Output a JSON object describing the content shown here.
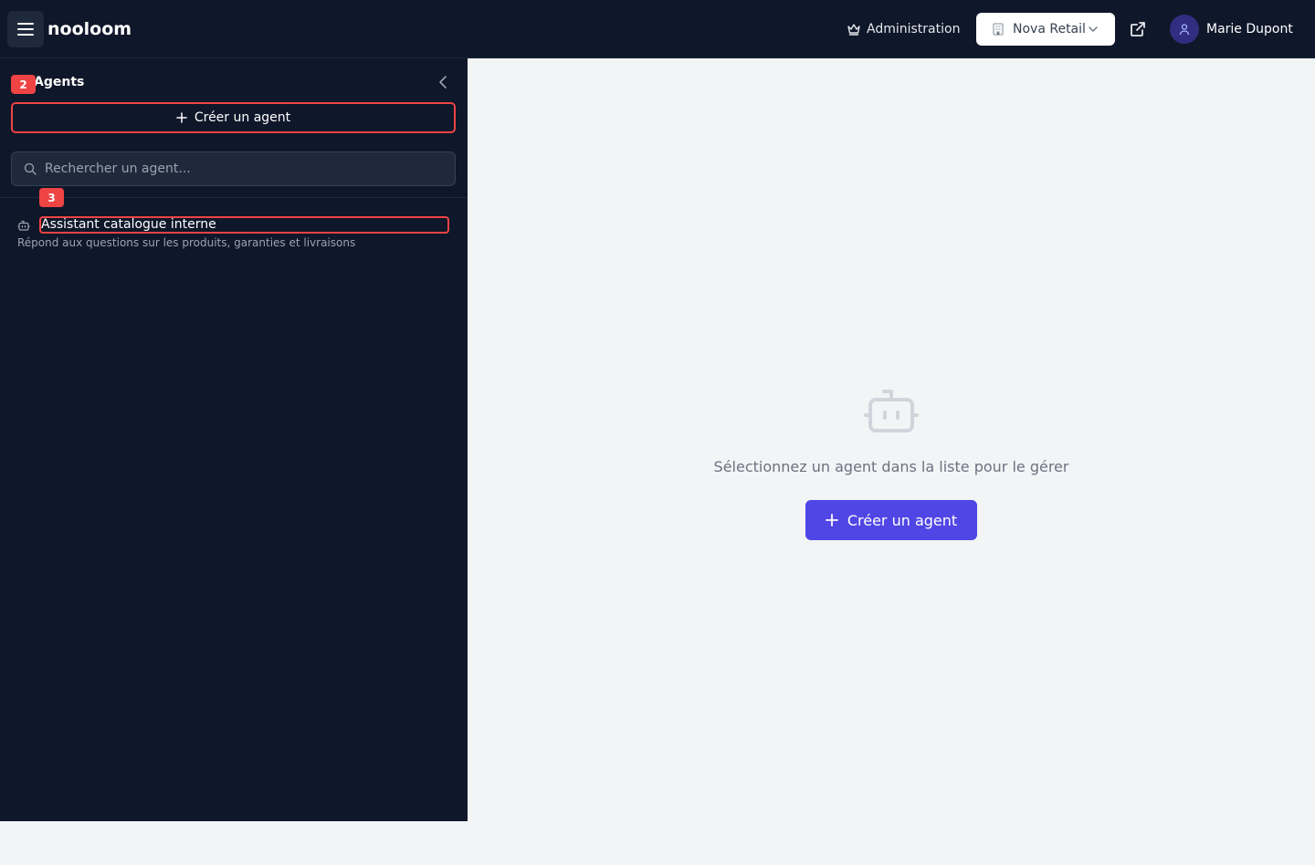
{
  "app": {
    "brand": "nooloom"
  },
  "header": {
    "admin_label": "Administration",
    "org_label": "Nova Retail",
    "user_name": "Marie Dupont"
  },
  "sidebar": {
    "title": "Agents",
    "create_label": "Créer un agent",
    "search": {
      "placeholder": "Rechercher un agent...",
      "value": ""
    },
    "items": [
      {
        "name": "Assistant catalogue interne",
        "description": "Répond aux questions sur les produits, garanties et livraisons"
      }
    ]
  },
  "annotations": {
    "badge_a": "2",
    "badge_b": "3"
  },
  "main": {
    "empty_message": "Sélectionnez un agent dans la liste pour le gérer",
    "create_label": "Créer un agent"
  },
  "colors": {
    "nav_bg": "#0f172a",
    "accent": "#4f46e5",
    "highlight": "#ef4444",
    "main_bg": "#f3f4f6"
  },
  "icons": [
    "menu-icon",
    "crown-icon",
    "building-icon",
    "chevron-down-icon",
    "external-link-icon",
    "user-icon",
    "chevron-left-icon",
    "plus-icon",
    "search-icon",
    "bot-icon"
  ]
}
